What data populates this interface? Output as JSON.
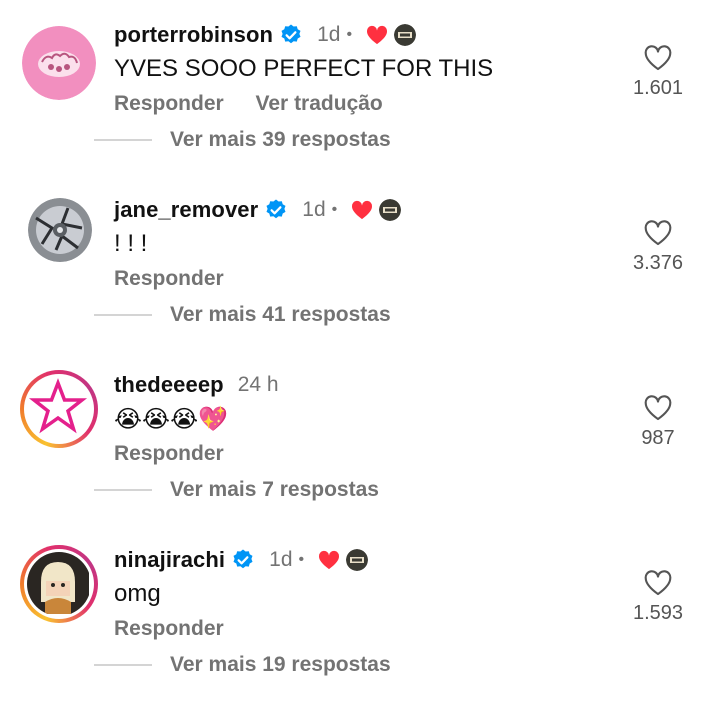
{
  "comments": [
    {
      "username": "porterrobinson",
      "verified": true,
      "time": "1d",
      "creator_liked": true,
      "text": "YVES SOOO PERFECT FOR THIS",
      "reply_label": "Responder",
      "translate_label": "Ver tradução",
      "like_count": "1.601",
      "more_replies": "Ver mais 39 respostas"
    },
    {
      "username": "jane_remover",
      "verified": true,
      "time": "1d",
      "creator_liked": true,
      "text": "! ! !",
      "reply_label": "Responder",
      "like_count": "3.376",
      "more_replies": "Ver mais 41 respostas"
    },
    {
      "username": "thedeeeep",
      "verified": false,
      "time": "24 h",
      "creator_liked": false,
      "text": "😭😭😭💖",
      "reply_label": "Responder",
      "like_count": "987",
      "more_replies": "Ver mais 7 respostas"
    },
    {
      "username": "ninajirachi",
      "verified": true,
      "time": "1d",
      "creator_liked": true,
      "text": "omg",
      "reply_label": "Responder",
      "like_count": "1.593",
      "more_replies": "Ver mais 19 respostas"
    }
  ],
  "colors": {
    "verified_blue": "#0095f6",
    "heart_red": "#ff3040",
    "muted_text": "#737373",
    "star_magenta": "#e4208c"
  },
  "icons": {
    "like": "heart-outline-icon",
    "creator_like": "heart-filled-icon",
    "verified": "verified-badge-icon"
  }
}
